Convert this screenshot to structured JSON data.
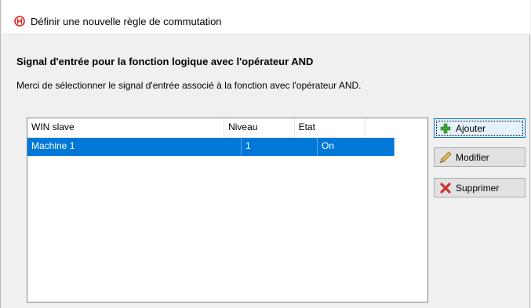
{
  "window": {
    "title": "Définir une nouvelle règle de commutation"
  },
  "section": {
    "title": "Signal d'entrée pour la fonction logique avec l'opérateur AND",
    "description": "Merci de sélectionner le signal d'entrée associé à la fonction avec l'opérateur AND."
  },
  "table": {
    "columns": [
      "WIN slave",
      "Niveau",
      "Etat",
      ""
    ],
    "rows": [
      {
        "win_slave": "Machine 1",
        "niveau": "1",
        "etat": "On",
        "selected": true
      }
    ]
  },
  "buttons": {
    "add_label": "Ajouter",
    "edit_label": "Modifier",
    "delete_label": "Supprimer"
  },
  "colors": {
    "selection": "#0078d7",
    "add_icon": "#3fa535",
    "delete_icon": "#d03030",
    "title_icon": "#d9261c"
  },
  "icons": {
    "title": "logic-symbol-icon",
    "add": "green-plus-icon",
    "edit": "pencil-icon",
    "delete": "red-x-icon"
  }
}
